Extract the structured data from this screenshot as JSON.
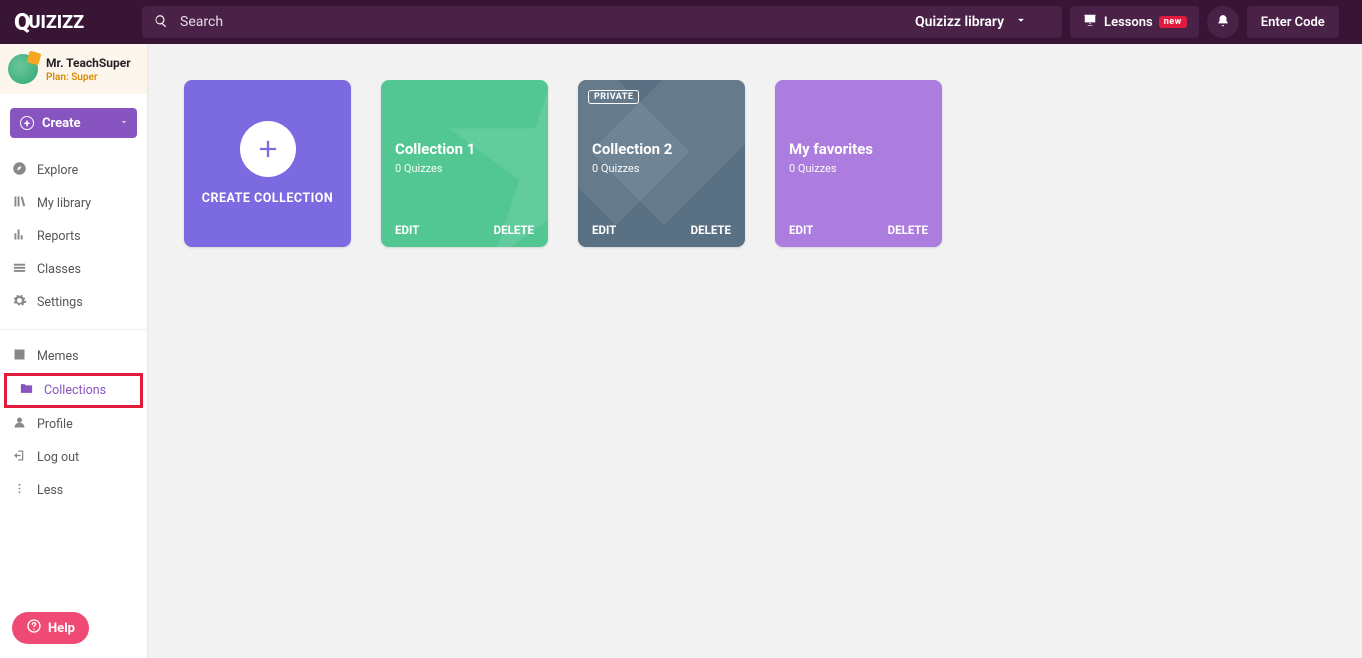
{
  "topbar": {
    "logo": "Quizizz",
    "search_placeholder": "Search",
    "library_label": "Quizizz library",
    "lessons_label": "Lessons",
    "new_badge": "new",
    "enter_code_label": "Enter Code"
  },
  "user": {
    "name": "Mr. TeachSuper",
    "plan_prefix": "Plan:",
    "plan_value": "Super"
  },
  "create_button": "Create",
  "nav_primary": [
    {
      "id": "explore",
      "label": "Explore"
    },
    {
      "id": "mylibrary",
      "label": "My library"
    },
    {
      "id": "reports",
      "label": "Reports"
    },
    {
      "id": "classes",
      "label": "Classes"
    },
    {
      "id": "settings",
      "label": "Settings"
    }
  ],
  "nav_secondary": [
    {
      "id": "memes",
      "label": "Memes"
    },
    {
      "id": "collections",
      "label": "Collections",
      "active": true
    },
    {
      "id": "profile",
      "label": "Profile"
    },
    {
      "id": "logout",
      "label": "Log out"
    },
    {
      "id": "less",
      "label": "Less"
    }
  ],
  "help_label": "Help",
  "create_collection_label": "CREATE COLLECTION",
  "actions": {
    "edit": "EDIT",
    "delete": "DELETE"
  },
  "private_badge": "PRIVATE",
  "collections": [
    {
      "title": "Collection 1",
      "sub": "0 Quizzes",
      "private": false
    },
    {
      "title": "Collection 2",
      "sub": "0 Quizzes",
      "private": true
    },
    {
      "title": "My favorites",
      "sub": "0 Quizzes",
      "private": false
    }
  ],
  "colors": {
    "brand": "#8854c0",
    "topbar": "#381535",
    "create_card": "#7b6ae0",
    "col1": "#52c794",
    "col2": "#5a7184",
    "col3": "#a36fdb",
    "help": "#ef4a73",
    "highlight": "#e21b3c"
  }
}
